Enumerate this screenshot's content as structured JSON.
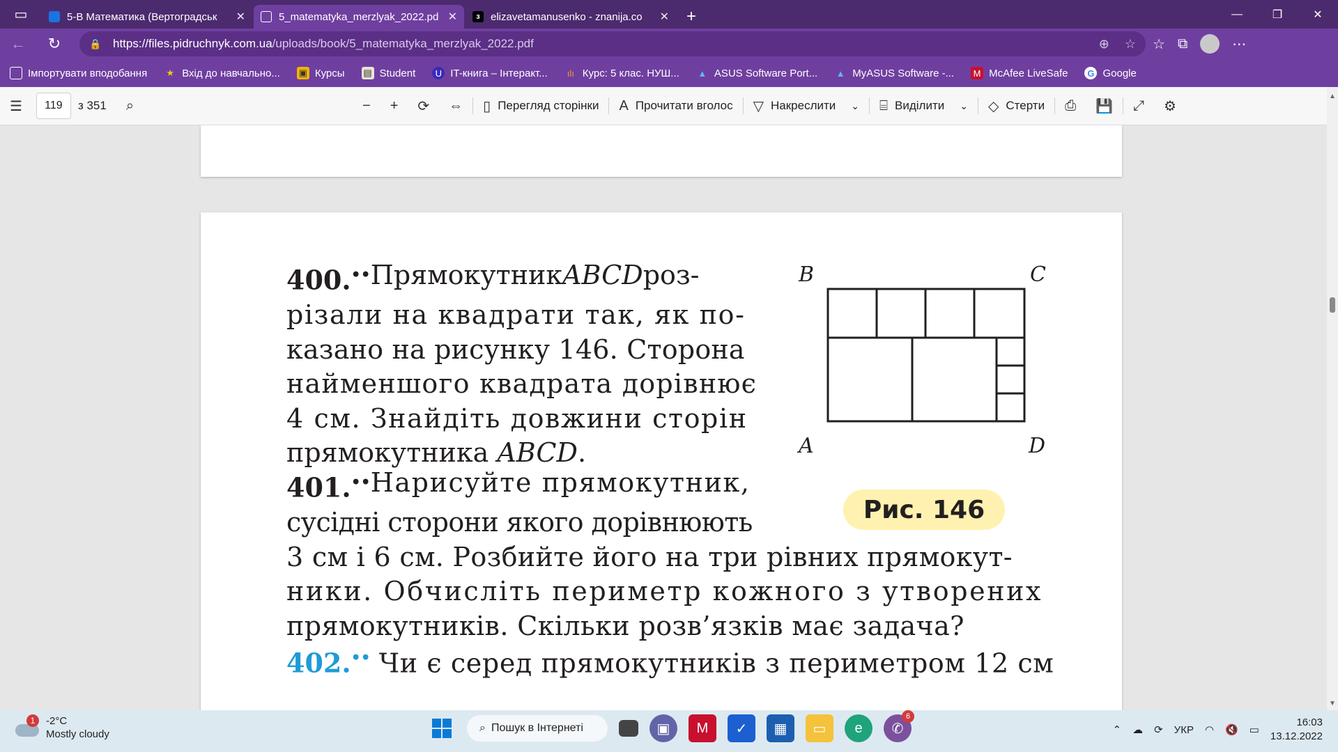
{
  "tabs": [
    {
      "title": "5-В Математика (Вертоградськ",
      "icon": "classroom-icon",
      "active": false
    },
    {
      "title": "5_matematyka_merzlyak_2022.pd",
      "icon": "pdf-icon",
      "active": true
    },
    {
      "title": "elizavetamanusenko - znanija.co",
      "icon": "znanija-icon",
      "active": false
    }
  ],
  "address": {
    "url_host": "https://files.pidruchnyk.com.ua",
    "url_path": "/uploads/book/5_matematyka_merzlyak_2022.pdf"
  },
  "bookmarks": [
    {
      "label": "Імпортувати вподобання",
      "icon": "import-icon"
    },
    {
      "label": "Вхід до навчально...",
      "icon": "star-icon"
    },
    {
      "label": "Курсы",
      "icon": "courses-icon"
    },
    {
      "label": "Student",
      "icon": "student-icon"
    },
    {
      "label": "IT-книга – Інтеракт...",
      "icon": "it-book-icon"
    },
    {
      "label": "Курс: 5 клас. НУШ...",
      "icon": "course-icon"
    },
    {
      "label": "ASUS Software Port...",
      "icon": "asus-icon"
    },
    {
      "label": "MyASUS Software -...",
      "icon": "myasus-icon"
    },
    {
      "label": "McAfee LiveSafe",
      "icon": "mcafee-icon"
    },
    {
      "label": "Google",
      "icon": "google-icon"
    }
  ],
  "pdf_toolbar": {
    "page_number": "119",
    "page_total": "з 351",
    "page_view": "Перегляд сторінки",
    "read_aloud": "Прочитати вголос",
    "draw": "Накреслити",
    "highlight": "Виділити",
    "erase": "Стерти"
  },
  "document": {
    "p400_num": "400.",
    "p400_lines": [
      [
        "Прямокутник",
        "ABCD",
        "роз-"
      ],
      "різали на квадрати так, як по-",
      "казано на рисунку 146. Сторона",
      "найменшого квадрата дорівнює",
      "4 см. Знайдіть довжини сторін",
      [
        "прямокутника ",
        "ABCD",
        "."
      ]
    ],
    "p401_num": "401.",
    "p401_lines": [
      "Нарисуйте прямокутник,",
      "сусідні сторони якого дорівнюють",
      "3 см і 6 см. Розбийте його на три рівних прямокут-",
      "ники. Обчисліть периметр кожного з утворених",
      "прямокутників. Скільки розв’язків має задача?"
    ],
    "p402_num": "402.",
    "p402_line": "Чи є серед прямокутників з периметром 12 см",
    "figure": {
      "caption": "Рис. 146",
      "labels": {
        "B": "B",
        "C": "C",
        "A": "A",
        "D": "D"
      }
    }
  },
  "taskbar": {
    "weather_temp": "-2°C",
    "weather_desc": "Mostly cloudy",
    "weather_badge": "1",
    "search": "Пошук в Інтернеті",
    "viber_badge": "6",
    "lang": "УКР",
    "time": "16:03",
    "date": "13.12.2022"
  },
  "colors": {
    "browser_dark": "#4c2a6e",
    "browser_main": "#6f3fa0",
    "exercise_blue": "#1e9bd7",
    "caption_bg": "#fff2b0"
  }
}
